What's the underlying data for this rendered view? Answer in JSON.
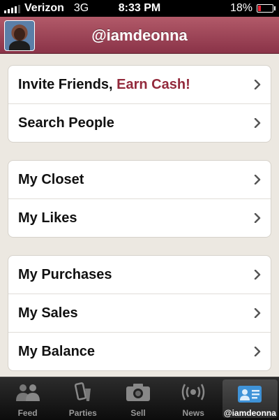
{
  "status_bar": {
    "carrier": "Verizon",
    "network": "3G",
    "time": "8:33 PM",
    "battery": "18%",
    "battery_level": 0.18
  },
  "header": {
    "username": "@iamdeonna"
  },
  "menu": {
    "group1": {
      "invite_prefix": "Invite Friends, ",
      "invite_accent": "Earn Cash!",
      "search": "Search People"
    },
    "group2": {
      "closet": "My Closet",
      "likes": "My Likes"
    },
    "group3": {
      "purchases": "My Purchases",
      "sales": "My Sales",
      "balance": "My Balance"
    }
  },
  "tabbar": {
    "tabs": [
      {
        "label": "Feed",
        "icon": "people-icon"
      },
      {
        "label": "Parties",
        "icon": "parties-icon"
      },
      {
        "label": "Sell",
        "icon": "camera-icon"
      },
      {
        "label": "News",
        "icon": "broadcast-icon"
      },
      {
        "label": "@iamdeonna",
        "icon": "profile-card-icon"
      }
    ],
    "active": 4
  },
  "colors": {
    "header": "#9b4557",
    "accent": "#932a3c",
    "background": "#ece8e1"
  }
}
